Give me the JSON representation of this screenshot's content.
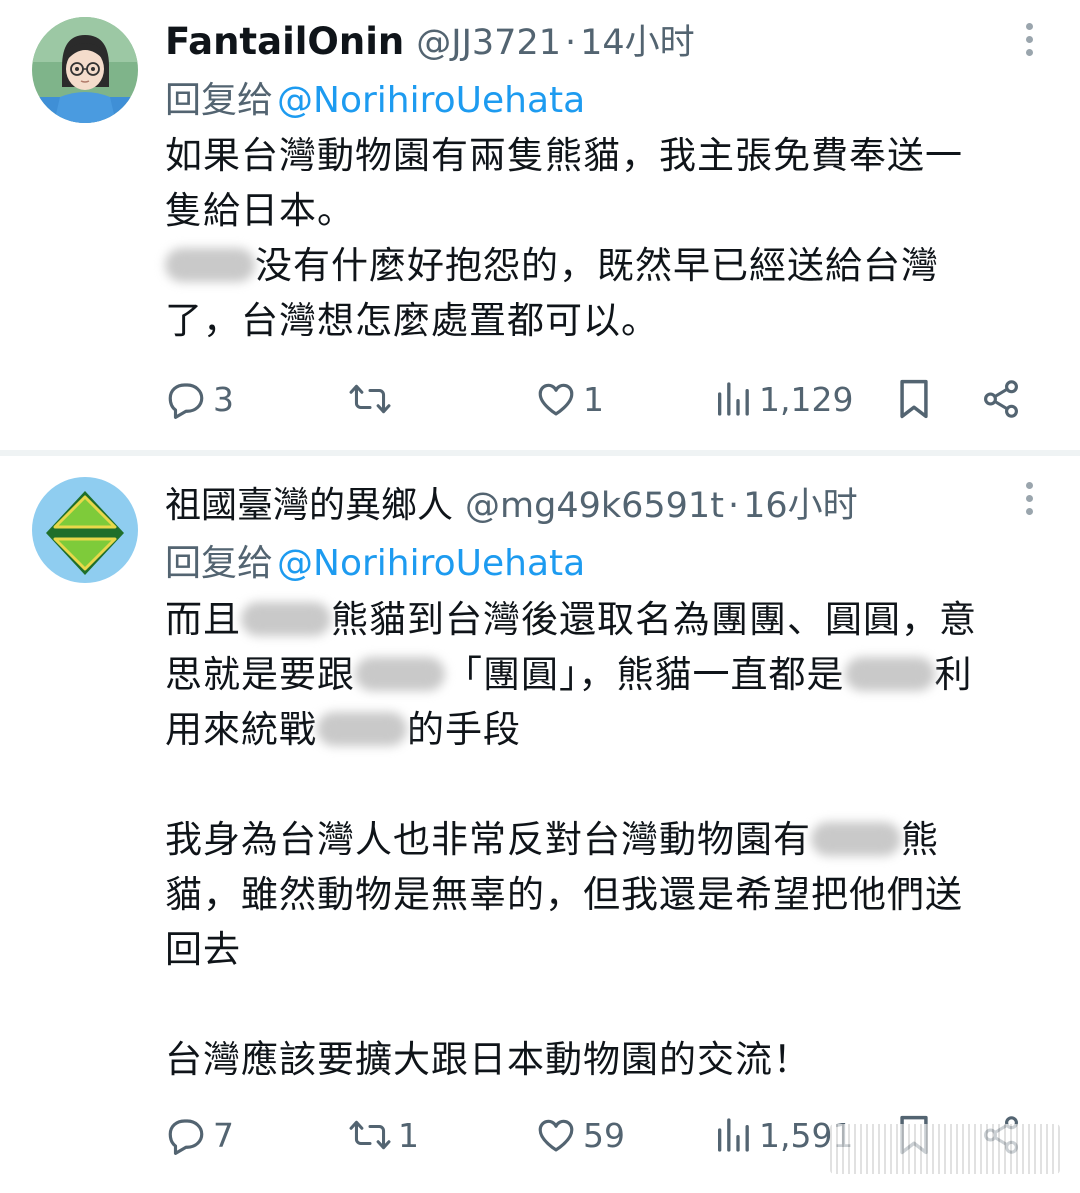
{
  "tweets": [
    {
      "display_name": "FantailOnin",
      "handle": "@JJ3721",
      "separator": "·",
      "time": "14小时",
      "reply_prefix": "回复给",
      "reply_to": "@NorihiroUehata",
      "lines": [
        "如果台灣動物園有兩隻熊貓，我主張免費奉送一",
        "隻給日本。",
        "没有什麼好抱怨的，既然早已經送給台灣",
        "了，台灣想怎麼處置都可以。"
      ],
      "stats": {
        "replies": "3",
        "retweets": "",
        "likes": "1",
        "views": "1,129"
      }
    },
    {
      "display_name": "祖國臺灣的異鄉人",
      "handle": "@mg49k6591t",
      "separator": "·",
      "time": "16小时",
      "reply_prefix": "回复给",
      "reply_to": "@NorihiroUehata",
      "lines": [
        "而且",
        "熊貓到台灣後還取名為團團、圓圓，意",
        "思就是要跟",
        "「團圓」，熊貓一直都是",
        "利",
        "用來統戰",
        "的手段",
        "我身為台灣人也非常反對台灣動物園有",
        "熊",
        "貓，雖然動物是無辜的，但我還是希望把他們送",
        "回去",
        "台灣應該要擴大跟日本動物園的交流！"
      ],
      "stats": {
        "replies": "7",
        "retweets": "1",
        "likes": "59",
        "views": "1,591"
      }
    }
  ],
  "icons": [
    "more-icon",
    "reply-icon",
    "retweet-icon",
    "like-icon",
    "views-icon",
    "bookmark-icon",
    "share-icon"
  ],
  "colors": {
    "link": "#1d9bf0",
    "muted": "#536471",
    "text": "#0f1419"
  }
}
